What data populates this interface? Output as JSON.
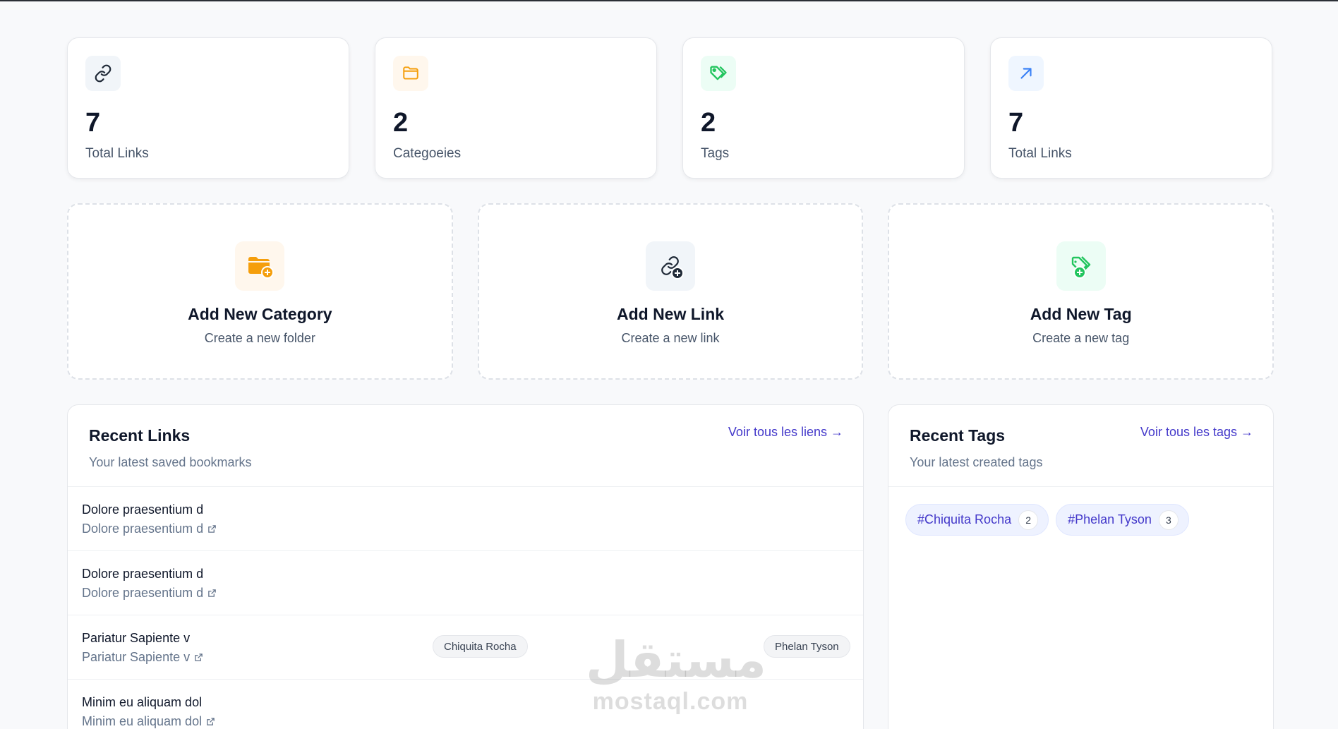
{
  "stats": [
    {
      "value": "7",
      "label": "Total Links",
      "icon": "link-icon",
      "bg": "#f1f5f9",
      "fg": "#1f2937"
    },
    {
      "value": "2",
      "label": "Categoeies",
      "icon": "folder-icon",
      "bg": "#fff7ed",
      "fg": "#f59e0b"
    },
    {
      "value": "2",
      "label": "Tags",
      "icon": "tags-icon",
      "bg": "#ecfdf5",
      "fg": "#22c55e"
    },
    {
      "value": "7",
      "label": "Total Links",
      "icon": "arrow-up-right-icon",
      "bg": "#eff6ff",
      "fg": "#3b82f6"
    }
  ],
  "actions": [
    {
      "title": "Add New Category",
      "subtitle": "Create a new folder",
      "icon": "folder-plus-icon"
    },
    {
      "title": "Add New Link",
      "subtitle": "Create a new link",
      "icon": "link-plus-icon"
    },
    {
      "title": "Add New Tag",
      "subtitle": "Create a new tag",
      "icon": "tag-plus-icon"
    }
  ],
  "recent_links": {
    "title": "Recent Links",
    "subtitle": "Your latest saved bookmarks",
    "view_all": "Voir tous les liens →",
    "items": [
      {
        "title": "Dolore praesentium d",
        "url": "Dolore praesentium d"
      },
      {
        "title": "Dolore praesentium d",
        "url": "Dolore praesentium d"
      },
      {
        "title": "Pariatur Sapiente v",
        "url": "Pariatur Sapiente v",
        "tags": [
          "Chiquita Rocha",
          "Phelan Tyson"
        ]
      },
      {
        "title": "Minim eu aliquam dol",
        "url": "Minim eu aliquam dol"
      }
    ]
  },
  "recent_tags": {
    "title": "Recent Tags",
    "subtitle": "Your latest created tags",
    "view_all": "Voir tous les tags →",
    "items": [
      {
        "name": "#Chiquita Rocha",
        "count": "2"
      },
      {
        "name": "#Phelan Tyson",
        "count": "3"
      }
    ]
  },
  "watermark": {
    "arabic": "مستقل",
    "latin": "mostaql.com"
  },
  "colors": {
    "accent": "#4338ca",
    "folder": "#f59e0b",
    "tag": "#22c55e",
    "link": "#1f2937"
  }
}
